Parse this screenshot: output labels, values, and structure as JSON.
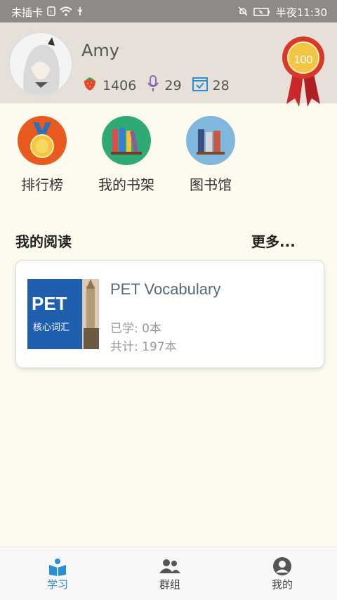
{
  "status_bar": {
    "carrier": "未插卡",
    "time": "半夜11:30"
  },
  "profile": {
    "name": "Amy",
    "stats": [
      {
        "icon": "strawberry-icon",
        "value": "1406"
      },
      {
        "icon": "microphone-icon",
        "value": "29"
      },
      {
        "icon": "calendar-check-icon",
        "value": "28"
      }
    ],
    "medal_number": "100"
  },
  "quick_links": [
    {
      "label": "排行榜",
      "icon": "medal-icon",
      "color": "#e85a1f"
    },
    {
      "label": "我的书架",
      "icon": "bookshelf-icon",
      "color": "#2eaa72"
    },
    {
      "label": "图书馆",
      "icon": "library-icon",
      "color": "#7fb7dd"
    }
  ],
  "my_reading": {
    "title": "我的阅读",
    "more": "更多...",
    "books": [
      {
        "title": "PET Vocabulary",
        "cover_main": "PET",
        "cover_sub": "核心词汇",
        "learned": "已学: 0本",
        "total": "共计: 197本"
      }
    ]
  },
  "tabs": [
    {
      "label": "学习",
      "icon": "book-reading-icon",
      "active": true
    },
    {
      "label": "群组",
      "icon": "group-icon",
      "active": false
    },
    {
      "label": "我的",
      "icon": "user-icon",
      "active": false
    }
  ],
  "colors": {
    "accent": "#2b8fd6",
    "header_bg": "#e6e0d8",
    "page_bg": "#fdfaee"
  }
}
